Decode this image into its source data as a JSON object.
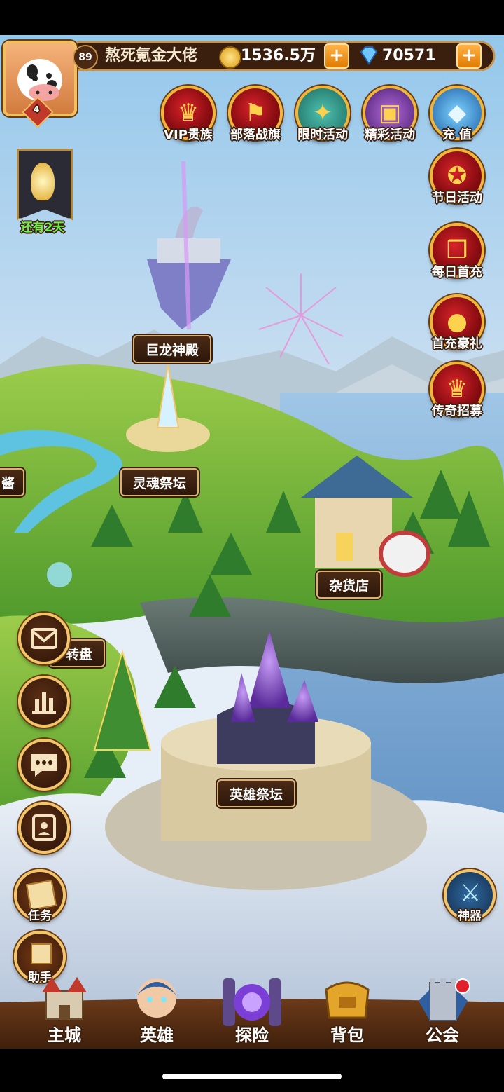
{
  "player": {
    "level": "89",
    "name": "熬死氪金大佬",
    "vip_rank": "4"
  },
  "currency": {
    "gold": "1536.5万",
    "diamonds": "70571"
  },
  "top_events": [
    {
      "label": "VIP贵族",
      "icon": "crown-icon"
    },
    {
      "label": "部落战旗",
      "icon": "banner-icon"
    },
    {
      "label": "限时活动",
      "icon": "compass-icon"
    },
    {
      "label": "精彩活动",
      "icon": "chest-icon"
    },
    {
      "label": "充 值",
      "icon": "diamond-icon"
    }
  ],
  "right_events": [
    {
      "label": "节日活动",
      "icon": "treasure-icon"
    },
    {
      "label": "每日首充",
      "icon": "gift-icon"
    },
    {
      "label": "首充豪礼",
      "icon": "money-bag-icon"
    },
    {
      "label": "传奇招募",
      "icon": "crown-icon"
    }
  ],
  "event_banner": {
    "label": "还有2天"
  },
  "map_buildings": {
    "dragon_temple": "巨龙神殿",
    "soul_altar": "灵魂祭坛",
    "shop": "杂货店",
    "wheel": "转盘",
    "hero_altar": "英雄祭坛",
    "left_partial": "酱"
  },
  "side_buttons": [
    {
      "name": "mail",
      "icon": "envelope-icon"
    },
    {
      "name": "ranking",
      "icon": "bar-chart-icon"
    },
    {
      "name": "chat",
      "icon": "chat-icon"
    },
    {
      "name": "friends",
      "icon": "contacts-icon"
    }
  ],
  "task_button": {
    "label": "任务"
  },
  "helper_button": {
    "label": "助手"
  },
  "artifact_button": {
    "label": "神器"
  },
  "bottom_nav": [
    {
      "label": "主城"
    },
    {
      "label": "英雄"
    },
    {
      "label": "探险"
    },
    {
      "label": "背包"
    },
    {
      "label": "公会"
    }
  ]
}
